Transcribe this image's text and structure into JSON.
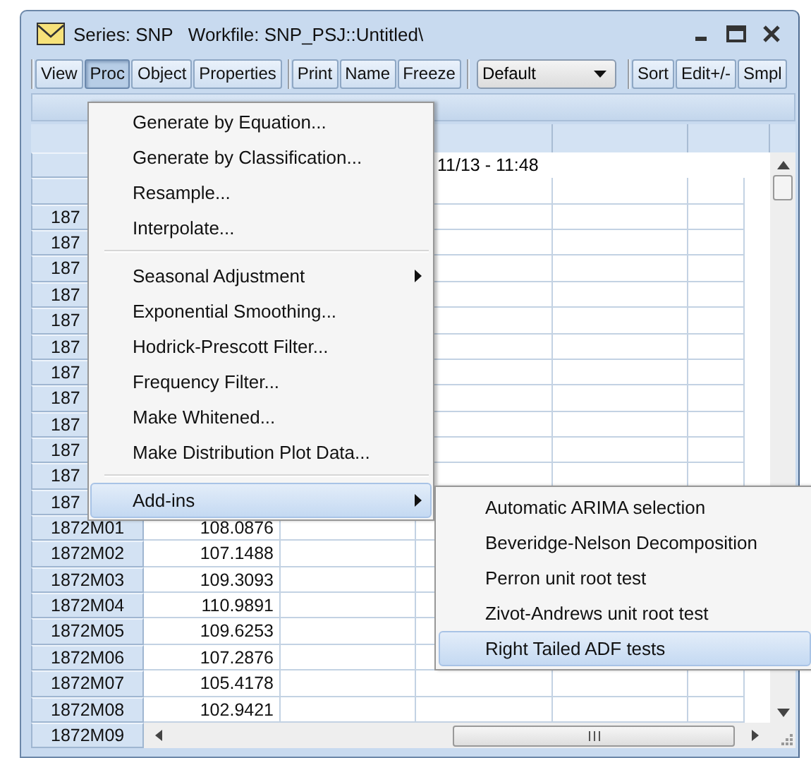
{
  "window": {
    "title": "Series: SNP   Workfile: SNP_PSJ::Untitled\\"
  },
  "toolbar_groups": [
    [
      {
        "kind": "button",
        "label": "View",
        "pressed": false
      },
      {
        "kind": "button",
        "label": "Proc",
        "pressed": true
      },
      {
        "kind": "button",
        "label": "Object",
        "pressed": false
      },
      {
        "kind": "button",
        "label": "Properties",
        "pressed": false
      }
    ],
    [
      {
        "kind": "button",
        "label": "Print",
        "pressed": false
      },
      {
        "kind": "button",
        "label": "Name",
        "pressed": false
      },
      {
        "kind": "button",
        "label": "Freeze",
        "pressed": false
      }
    ],
    [
      {
        "kind": "dropdown",
        "value": "Default"
      }
    ],
    [
      {
        "kind": "button",
        "label": "Sort",
        "pressed": false
      },
      {
        "kind": "button",
        "label": "Edit+/-",
        "pressed": false
      },
      {
        "kind": "button",
        "label": "Smpl",
        "pressed": false
      }
    ]
  ],
  "spreadsheet": {
    "info_text": "11/13 - 11:48",
    "rows": [
      {
        "label": "187"
      },
      {
        "label": "187"
      },
      {
        "label": "187"
      },
      {
        "label": "187"
      },
      {
        "label": "187"
      },
      {
        "label": "187"
      },
      {
        "label": "187"
      },
      {
        "label": "187"
      },
      {
        "label": "187"
      },
      {
        "label": "187"
      },
      {
        "label": "187"
      },
      {
        "label": "187"
      },
      {
        "label": "1872M01",
        "value": "108.0876"
      },
      {
        "label": "1872M02",
        "value": "107.1488"
      },
      {
        "label": "1872M03",
        "value": "109.3093"
      },
      {
        "label": "1872M04",
        "value": "110.9891"
      },
      {
        "label": "1872M05",
        "value": "109.6253"
      },
      {
        "label": "1872M06",
        "value": "107.2876"
      },
      {
        "label": "1872M07",
        "value": "105.4178"
      },
      {
        "label": "1872M08",
        "value": "102.9421"
      }
    ],
    "last_row_label": "1872M09"
  },
  "menu": {
    "items": [
      {
        "kind": "item",
        "label": "Generate by Equation...",
        "submenu": false,
        "selected": false
      },
      {
        "kind": "item",
        "label": "Generate by Classification...",
        "submenu": false,
        "selected": false
      },
      {
        "kind": "item",
        "label": "Resample...",
        "submenu": false,
        "selected": false
      },
      {
        "kind": "item",
        "label": "Interpolate...",
        "submenu": false,
        "selected": false
      },
      {
        "kind": "separator"
      },
      {
        "kind": "item",
        "label": "Seasonal Adjustment",
        "submenu": true,
        "selected": false
      },
      {
        "kind": "item",
        "label": "Exponential Smoothing...",
        "submenu": false,
        "selected": false
      },
      {
        "kind": "item",
        "label": "Hodrick-Prescott Filter...",
        "submenu": false,
        "selected": false
      },
      {
        "kind": "item",
        "label": "Frequency Filter...",
        "submenu": false,
        "selected": false
      },
      {
        "kind": "item",
        "label": "Make Whitened...",
        "submenu": false,
        "selected": false
      },
      {
        "kind": "item",
        "label": "Make Distribution Plot Data...",
        "submenu": false,
        "selected": false
      },
      {
        "kind": "separator"
      },
      {
        "kind": "item",
        "label": "Add-ins",
        "submenu": true,
        "selected": true
      }
    ]
  },
  "submenu": {
    "items": [
      {
        "kind": "item",
        "label": "Automatic ARIMA selection",
        "selected": false
      },
      {
        "kind": "item",
        "label": "Beveridge-Nelson Decomposition",
        "selected": false
      },
      {
        "kind": "item",
        "label": "Perron unit root test",
        "selected": false
      },
      {
        "kind": "item",
        "label": "Zivot-Andrews unit root test",
        "selected": false
      },
      {
        "kind": "item",
        "label": "Right Tailed ADF tests",
        "selected": true
      }
    ]
  }
}
